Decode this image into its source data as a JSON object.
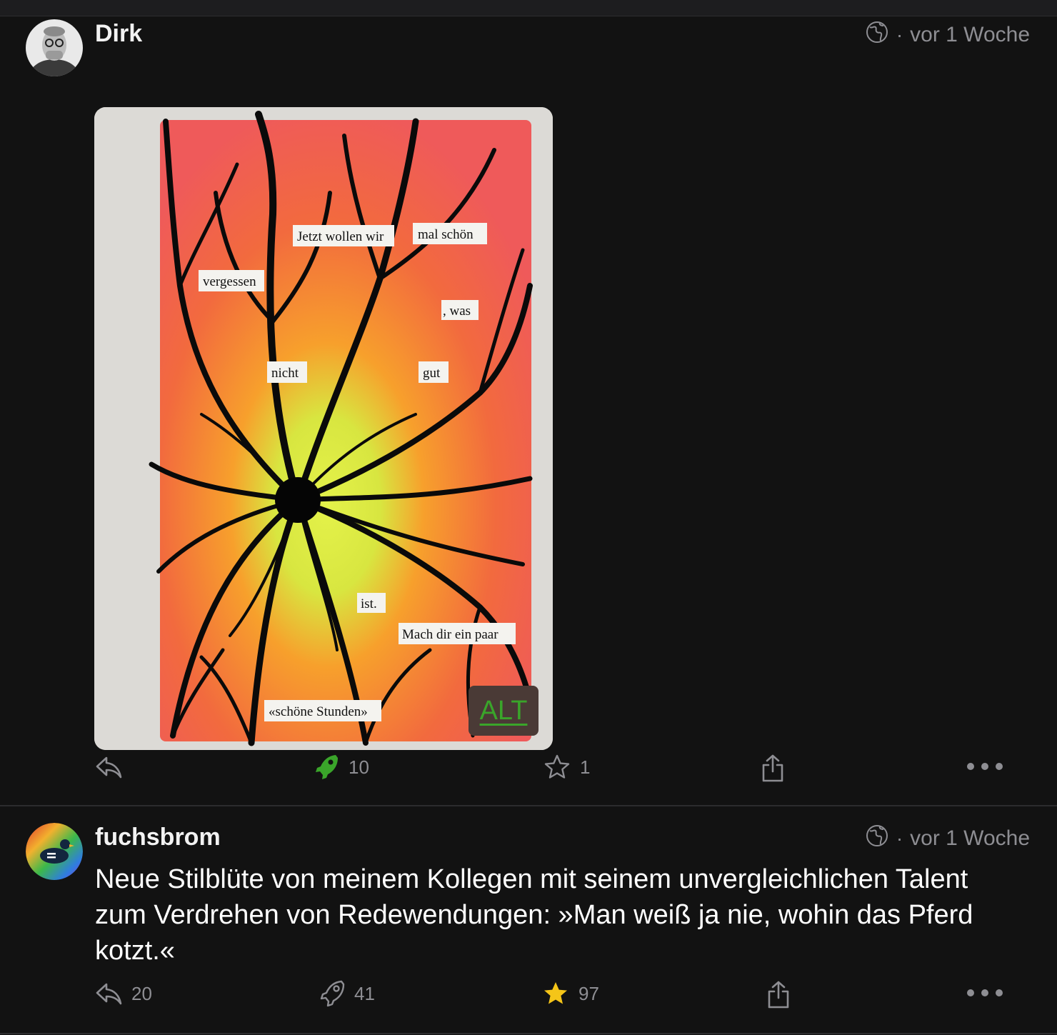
{
  "posts": [
    {
      "username": "Dirk",
      "time": "vor 1 Woche",
      "visibility_icon": "globe-icon",
      "media": {
        "alt_label": "ALT",
        "words": [
          "Jetzt wollen wir",
          "mal schön",
          "vergessen",
          ", was",
          "nicht",
          "gut",
          "ist.",
          "Mach dir ein paar",
          "«schöne Stunden»"
        ]
      },
      "actions": {
        "reply_count": "",
        "boost_count": "10",
        "favorite_count": "1"
      },
      "boosted": true,
      "favorited": false
    },
    {
      "username": "fuchsbrom",
      "time": "vor 1 Woche",
      "visibility_icon": "globe-icon",
      "text": "Neue Stilblüte von meinem Kollegen mit seinem unvergleichlichen Talent zum Verdrehen von Redewendungen: »Man weiß ja nie, wohin das Pferd kotzt.«",
      "actions": {
        "reply_count": "20",
        "boost_count": "41",
        "favorite_count": "97"
      },
      "boosted": false,
      "favorited": true
    }
  ],
  "colors": {
    "background": "#121212",
    "muted": "#8e8e93",
    "boost_active": "#3aa52a",
    "favorite_active": "#f5c518"
  }
}
